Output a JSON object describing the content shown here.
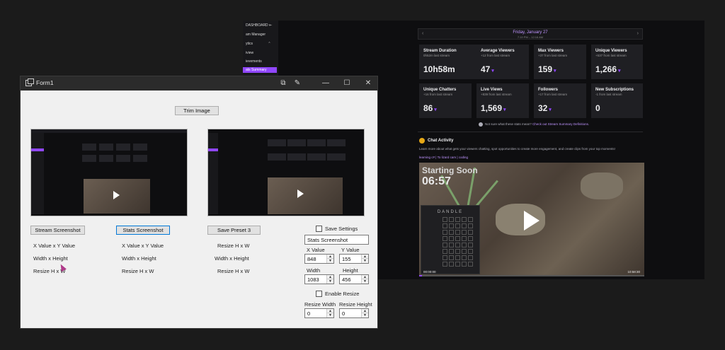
{
  "background_app": {
    "nav": {
      "items": [
        {
          "label": "DASHBOARD"
        },
        {
          "label": "am Manager"
        },
        {
          "label": "ytics"
        },
        {
          "label": "iview"
        },
        {
          "label": "ievements"
        },
        {
          "label": "ats Summary"
        }
      ]
    },
    "date": {
      "label": "Friday, January 27",
      "time": "7:19 PM – 12:16 AM"
    },
    "stats": [
      {
        "title": "Stream Duration",
        "sub": "0h52m last stream",
        "value": "10h58m"
      },
      {
        "title": "Average Viewers",
        "sub": "+12 from last stream",
        "value": "47"
      },
      {
        "title": "Max Viewers",
        "sub": "+37 from last stream",
        "value": "159"
      },
      {
        "title": "Unique Viewers",
        "sub": "+537 from last stream",
        "value": "1,266"
      },
      {
        "title": "Unique Chatters",
        "sub": "+16 from last stream",
        "value": "86"
      },
      {
        "title": "Live Views",
        "sub": "+839 from last stream",
        "value": "1,569"
      },
      {
        "title": "Followers",
        "sub": "+17 from last stream",
        "value": "32"
      },
      {
        "title": "New Subscriptions",
        "sub": "-1 from last stream",
        "value": "0"
      }
    ],
    "stats_note": "Not sure what these stats mean?",
    "stats_note_link": "Check out Stream Summary Definitions.",
    "chat": {
      "title": "Chat Activity",
      "description": "Learn more about what gets your viewers chatting, spot opportunities to create more engagement, and create clips from your top moments!",
      "tags": "learning c# | To lizard cam | coding"
    },
    "video": {
      "overlay_title": "Starting Soon",
      "overlay_time": "06:57",
      "panel_brand": "DANDLE",
      "time_start": "00:00:00",
      "time_end": "10:58:30"
    }
  },
  "form": {
    "title": "Form1",
    "trim_label": "Trim Image",
    "columns": [
      {
        "button": "Stream Screenshot",
        "xy": "X Value x Y Value",
        "wh": "Width x Height",
        "resize": "Resize H x W"
      },
      {
        "button": "Stats Screenshot",
        "xy": "X Value x Y Value",
        "wh": "Width x Height",
        "resize": "Resize H x W"
      },
      {
        "button": "Save Preset 3",
        "xy": "Resize H x W",
        "wh": "Width x Height",
        "resize": "Resize H x W"
      }
    ],
    "settings": {
      "save_settings": "Save Settings",
      "preset_name": "Stats Screenshot",
      "x_label": "X Value",
      "y_label": "Y Value",
      "x_value": "848",
      "y_value": "155",
      "width_label": "Width",
      "height_label": "Height",
      "width_value": "1083",
      "height_value": "456",
      "enable_resize": "Enable Resize",
      "resize_width_label": "Resize Width",
      "resize_height_label": "Resize Height",
      "resize_width_value": "0",
      "resize_height_value": "0"
    }
  },
  "colors": {
    "accent": "#9147ff",
    "dark_bg": "#0e0e10",
    "form_bg": "#f0f0f0"
  }
}
